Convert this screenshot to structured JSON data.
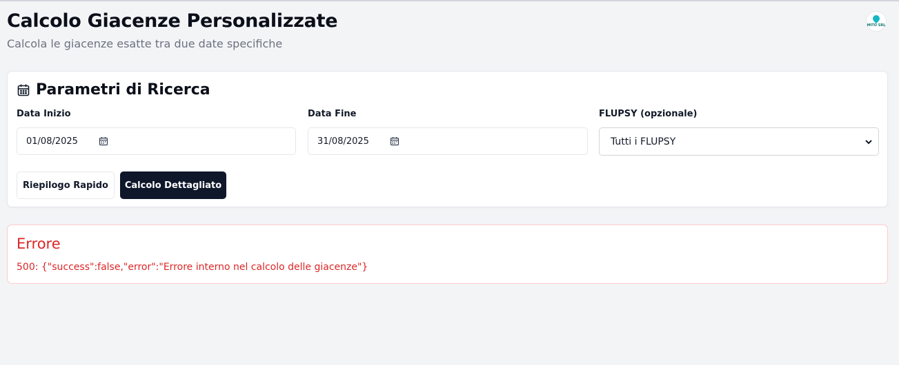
{
  "header": {
    "title": "Calcolo Giacenze Personalizzate",
    "subtitle": "Calcola le giacenze esatte tra due date specifiche",
    "logo_text": "MITO SRL"
  },
  "search": {
    "title": "Parametri di Ricerca",
    "start_date": {
      "label": "Data Inizio",
      "value": "01/08/2025"
    },
    "end_date": {
      "label": "Data Fine",
      "value": "31/08/2025"
    },
    "flupsy": {
      "label": "FLUPSY (opzionale)",
      "selected": "Tutti i FLUPSY"
    },
    "quick_button": "Riepilogo Rapido",
    "detail_button": "Calcolo Dettagliato"
  },
  "error": {
    "title": "Errore",
    "message": "500: {\"success\":false,\"error\":\"Errore interno nel calcolo delle giacenze\"}"
  },
  "colors": {
    "background": "#f3f4f6",
    "primary_button": "#0f172a",
    "error": "#dc2626",
    "logo_accent": "#14b8c4"
  },
  "icons": {
    "card_title": "calendar-icon",
    "date_field": "calendar-picker-icon",
    "select": "chevron-down-icon"
  }
}
